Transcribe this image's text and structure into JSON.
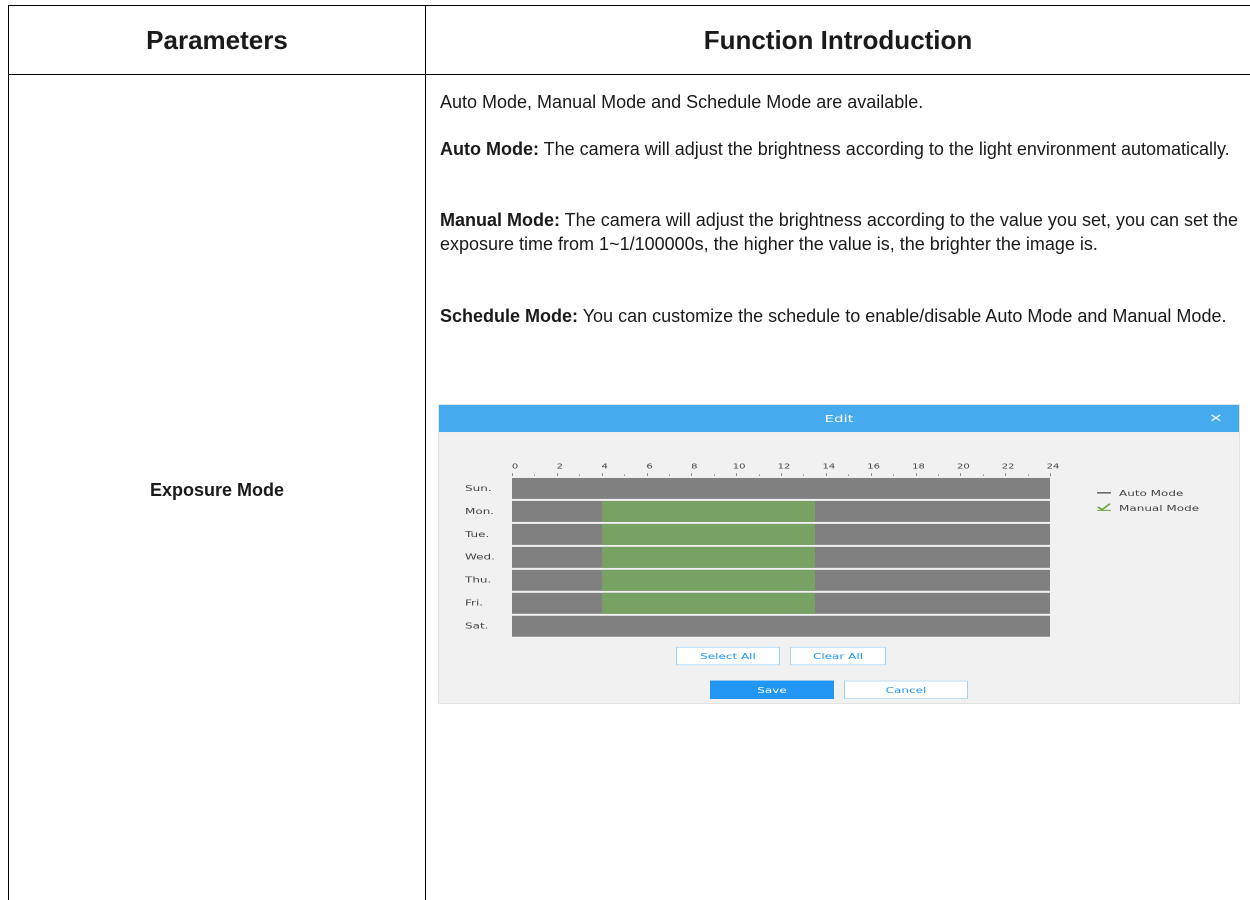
{
  "table": {
    "headers": [
      "Parameters",
      "Function Introduction"
    ],
    "parameter": "Exposure Mode",
    "intro": {
      "line1": "Auto Mode, Manual Mode and Schedule Mode are available.",
      "auto_label": "Auto Mode:",
      "auto_text": " The camera will adjust the brightness according to the light environment automatically.",
      "manual_label": "Manual Mode:",
      "manual_text": " The camera will adjust the brightness according to the value you set, you can set the exposure time from 1~1/100000s, the higher the value is, the brighter the image is.",
      "schedule_label": "Schedule Mode:",
      "schedule_text": " You can customize the schedule to enable/disable Auto Mode and Manual Mode."
    }
  },
  "dialog": {
    "title": "Edit",
    "close_icon": "close-icon",
    "hour_ticks": [
      "0",
      "2",
      "4",
      "6",
      "8",
      "10",
      "12",
      "14",
      "16",
      "18",
      "20",
      "22",
      "24"
    ],
    "days": [
      "Sun.",
      "Mon.",
      "Tue.",
      "Wed.",
      "Thu.",
      "Fri.",
      "Sat."
    ],
    "schedule": [
      {
        "day": "Sun.",
        "manual": []
      },
      {
        "day": "Mon.",
        "manual": [
          [
            4,
            13.5
          ]
        ]
      },
      {
        "day": "Tue.",
        "manual": [
          [
            4,
            13.5
          ]
        ]
      },
      {
        "day": "Wed.",
        "manual": [
          [
            4,
            13.5
          ]
        ]
      },
      {
        "day": "Thu.",
        "manual": [
          [
            4,
            13.5
          ]
        ]
      },
      {
        "day": "Fri.",
        "manual": [
          [
            4,
            13.5
          ]
        ]
      },
      {
        "day": "Sat.",
        "manual": []
      }
    ],
    "legend": {
      "auto": "Auto Mode",
      "manual": "Manual Mode",
      "auto_color": "#808080",
      "manual_color": "#78a263",
      "manual_icon": "checkmark-icon",
      "auto_icon": "dash-icon",
      "selected_mode": "Manual Mode"
    },
    "buttons": {
      "select_all": "Select All",
      "clear_all": "Clear All",
      "save": "Save",
      "cancel": "Cancel"
    },
    "colors": {
      "title_bar": "#45aaee",
      "primary": "#2196f3"
    }
  }
}
